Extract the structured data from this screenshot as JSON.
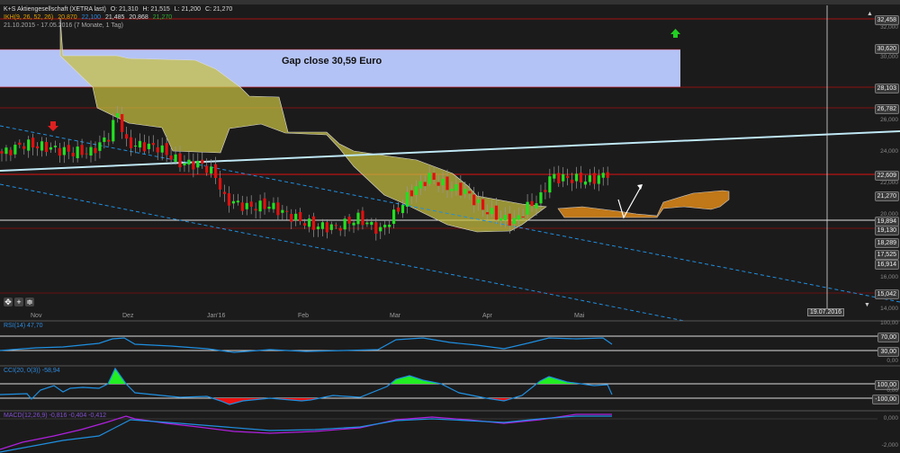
{
  "header": {
    "instrument": "K+S Aktiengesellschaft (XETRA last)",
    "open": "O: 21,310",
    "high": "H: 21,515",
    "low": "L: 21,200",
    "close": "C: 21,270",
    "ikh_label": "IKH(9, 26, 52, 26)",
    "ikh_v1": "20,870",
    "ikh_v2": "22,100",
    "ikh_v3": "21,485",
    "ikh_v4": "20,868",
    "ikh_v5": "21,270",
    "range": "21.10.2015 - 17.05.2016 (7 Monate, 1 Tag)"
  },
  "annotation": {
    "gap_text": "Gap close 30,59 Euro"
  },
  "price_axis": [
    "32,000",
    "30,000",
    "26,000",
    "24,000",
    "22,000",
    "20,000",
    "16,000",
    "14,000"
  ],
  "price_tags": [
    "32,458",
    "30,620",
    "28,103",
    "26,782",
    "22,609",
    "21,270",
    "19,894",
    "19,130",
    "18,289",
    "17,525",
    "16,914",
    "15,042"
  ],
  "months": [
    "Nov",
    "Dez",
    "Jan'16",
    "Feb",
    "Mar",
    "Apr",
    "Mai"
  ],
  "crosshair_date": "19.07.2016",
  "rsi": {
    "label": "RSI(14) 47,70",
    "axis": [
      "100,00",
      "0,00"
    ],
    "tags": [
      "70,00",
      "30,00"
    ]
  },
  "cci": {
    "label": "CCI(20, 0(3)) -58,94",
    "axis": [
      "0,00"
    ],
    "tags": [
      "100,00",
      "-100,00"
    ]
  },
  "macd": {
    "label": "MACD(12,26,9) -0,816 -0,404 -0,412",
    "axis": [
      "0,000",
      "-2,000"
    ]
  },
  "colors": {
    "up": "#22e022",
    "down": "#e01010",
    "cloud": "#c8c040",
    "future_cloud": "#c07818",
    "gap": "#b4c3f5"
  },
  "price_path": [
    [
      0,
      23.9
    ],
    [
      5,
      24.5
    ],
    [
      10,
      24.3
    ],
    [
      15,
      24.0
    ],
    [
      20,
      24.0
    ],
    [
      24,
      25.0
    ],
    [
      26,
      26.5
    ],
    [
      28,
      24.5
    ],
    [
      35,
      24.3
    ],
    [
      40,
      23.3
    ],
    [
      45,
      23.2
    ],
    [
      48,
      22.5
    ],
    [
      50,
      21.0
    ],
    [
      55,
      20.5
    ],
    [
      60,
      20.6
    ],
    [
      65,
      19.9
    ],
    [
      70,
      19.3
    ],
    [
      75,
      19.2
    ],
    [
      80,
      19.8
    ],
    [
      85,
      19.0
    ],
    [
      88,
      20.0
    ],
    [
      92,
      21.5
    ],
    [
      96,
      22.4
    ],
    [
      100,
      21.8
    ],
    [
      104,
      21.5
    ],
    [
      108,
      20.4
    ],
    [
      112,
      19.8
    ],
    [
      115,
      19.6
    ],
    [
      118,
      20.5
    ],
    [
      121,
      21.1
    ],
    [
      123,
      22.4
    ],
    [
      128,
      22.3
    ],
    [
      132,
      22.2
    ],
    [
      135,
      22.5
    ],
    [
      136,
      22.7
    ]
  ]
}
